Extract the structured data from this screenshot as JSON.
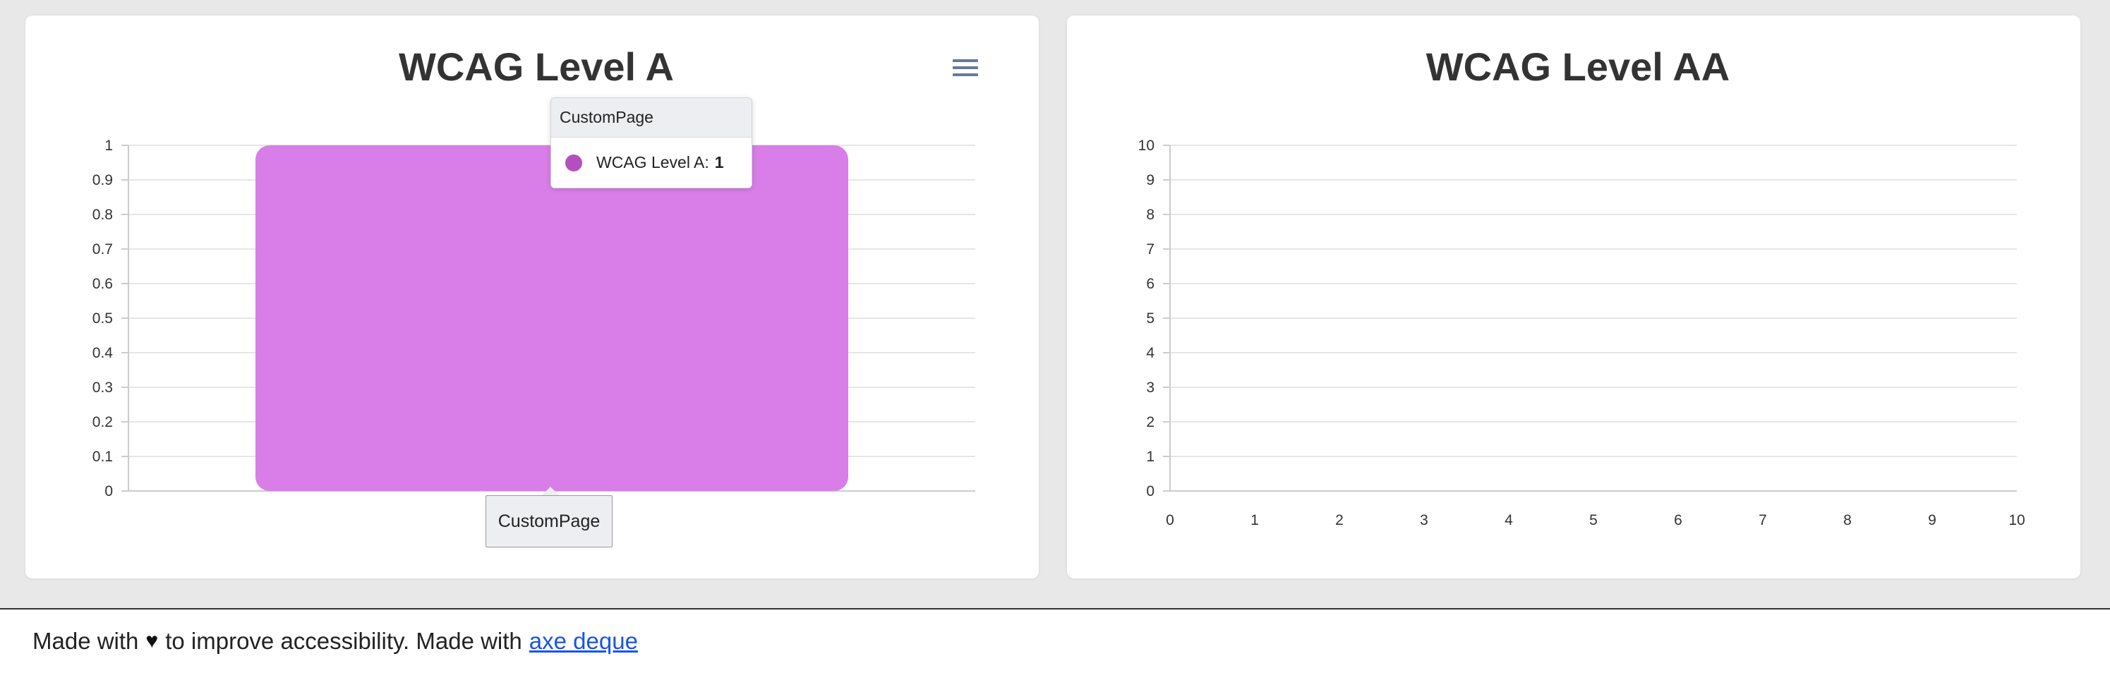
{
  "chart_data": [
    {
      "type": "bar",
      "title": "WCAG Level A",
      "categories": [
        "CustomPage"
      ],
      "series": [
        {
          "name": "WCAG Level A",
          "values": [
            1
          ]
        }
      ],
      "ylim": [
        0,
        1
      ],
      "yticks": [
        "0",
        "0.1",
        "0.2",
        "0.3",
        "0.4",
        "0.5",
        "0.6",
        "0.7",
        "0.8",
        "0.9",
        "1"
      ],
      "grid": true,
      "bar_color": "#d97ee9"
    },
    {
      "type": "bar",
      "title": "WCAG Level AA",
      "categories": [],
      "series": [],
      "ylim": [
        0,
        10
      ],
      "xlim": [
        0,
        10
      ],
      "yticks": [
        "0",
        "1",
        "2",
        "3",
        "4",
        "5",
        "6",
        "7",
        "8",
        "9",
        "10"
      ],
      "xticks": [
        "0",
        "1",
        "2",
        "3",
        "4",
        "5",
        "6",
        "7",
        "8",
        "9",
        "10"
      ],
      "grid": true
    }
  ],
  "tooltip": {
    "header": "CustomPage",
    "series_label": "WCAG Level A:",
    "value": "1",
    "dot_color": "#b54fbf"
  },
  "x_tooltip": "CustomPage",
  "menu_icon": "hamburger-menu-icon",
  "footer": {
    "text_before": "Made with",
    "heart_icon": "♥",
    "text_after": "to improve accessibility. Made with",
    "link_text": "axe deque"
  }
}
